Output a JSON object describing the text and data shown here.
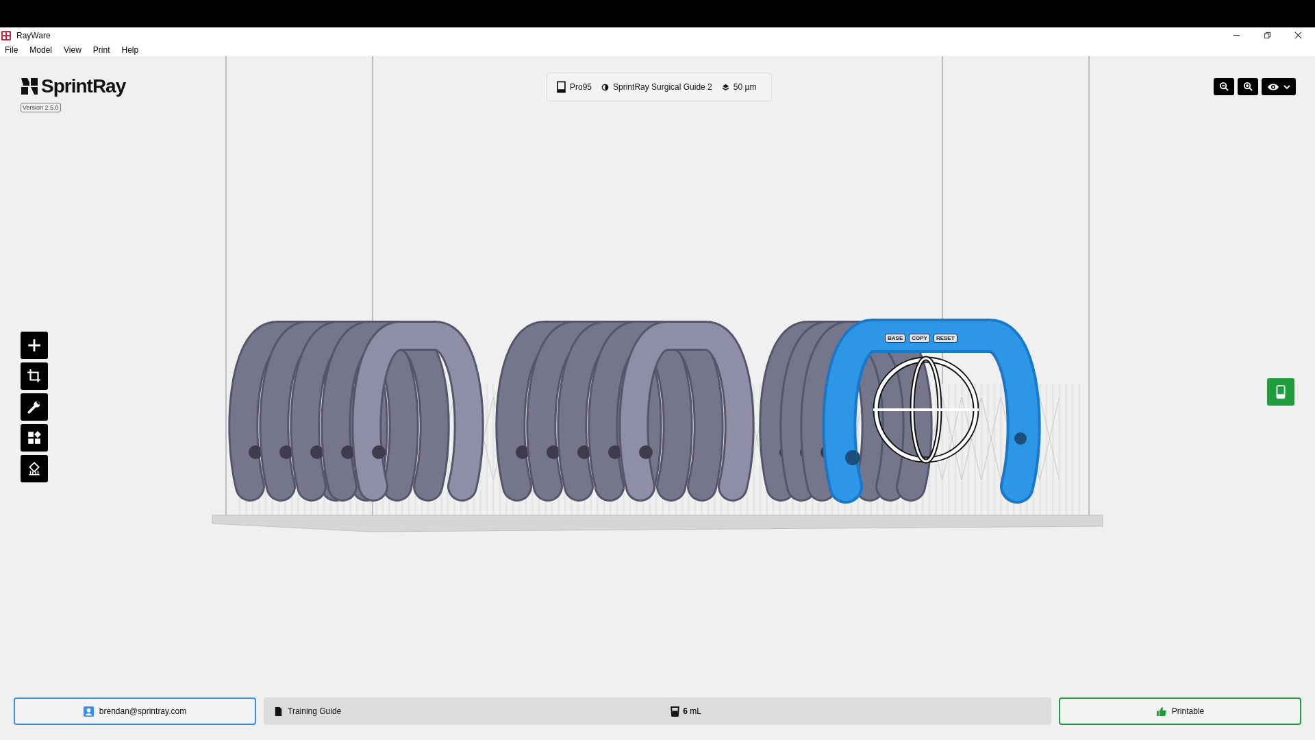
{
  "window": {
    "title": "RayWare"
  },
  "menu": [
    "File",
    "Model",
    "View",
    "Print",
    "Help"
  ],
  "brand": {
    "name": "SprintRay",
    "version": "Version 2.5.0"
  },
  "print_setup": {
    "printer": "Pro95",
    "resin": "SprintRay Surgical Guide 2",
    "layer": "50 µm"
  },
  "gizmo_buttons": [
    "BASE",
    "COPY",
    "RESET"
  ],
  "status_bar": {
    "account": "brendan@sprintray.com",
    "guide": "Training Guide",
    "volume": "**6** mL",
    "status": "Printable"
  }
}
